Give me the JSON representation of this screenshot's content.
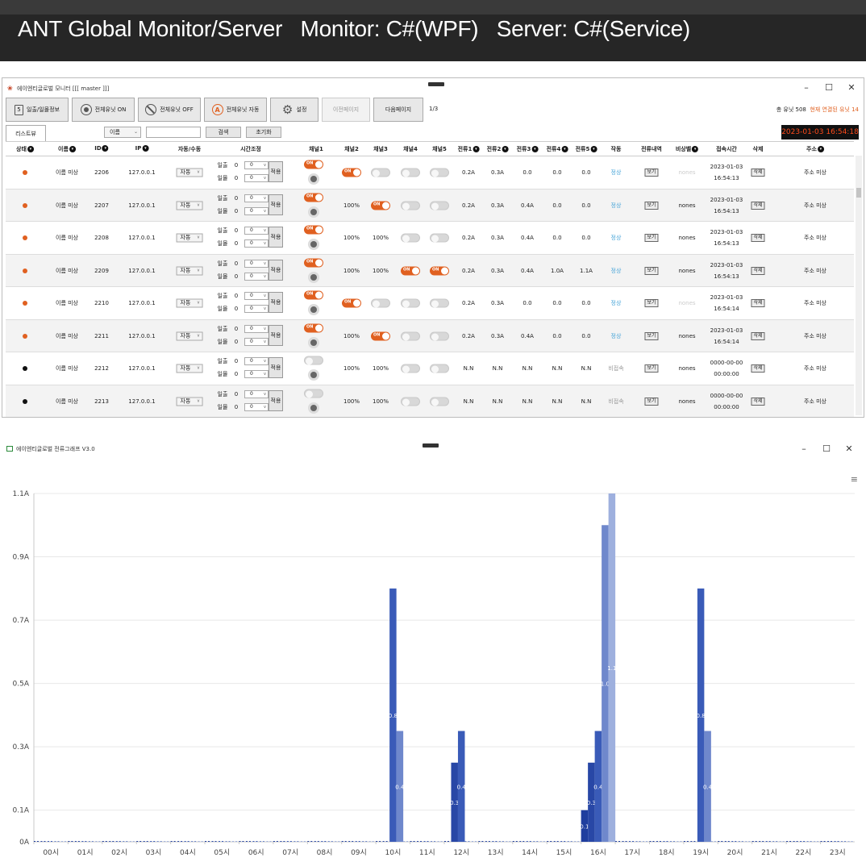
{
  "banner": {
    "title": "ANT Global Monitor/Server   Monitor: C#(WPF)   Server: C#(Service)"
  },
  "monitor": {
    "window_title": "에이엔티글로벌 모니터 [[[ master ]]]",
    "toolbar": {
      "daily_info": "일출/일몰정보",
      "all_on": "전체유닛 ON",
      "all_off": "전체유닛 OFF",
      "all_auto": "전체유닛 자동",
      "settings": "설정",
      "prev_page": "이전페이지",
      "next_page": "다음페이지",
      "page": "1/3",
      "total_units": "총 유닛 508",
      "connected_units": "현재 연결된 유닛 14"
    },
    "filter": {
      "tab": "리스트뷰",
      "field_select": "이름",
      "search_value": "",
      "search_btn": "검색",
      "reset_btn": "초기화",
      "clock": "2023-01-03 16:54:18"
    },
    "columns": [
      "상태",
      "이름",
      "ID",
      "IP",
      "자동/수동",
      "시간조정",
      "채널1",
      "채널2",
      "채널3",
      "채널4",
      "채널5",
      "전류1",
      "전류2",
      "전류3",
      "전류4",
      "전류5",
      "작동",
      "전류내역",
      "비상벨",
      "접속시간",
      "삭제",
      "주소"
    ],
    "sortable": [
      true,
      true,
      true,
      true,
      false,
      false,
      false,
      false,
      false,
      false,
      false,
      true,
      true,
      true,
      true,
      true,
      false,
      false,
      true,
      false,
      false,
      true
    ],
    "time_labels": {
      "sunrise": "일출",
      "sunset": "일몰",
      "zero": "0",
      "apply": "적용"
    },
    "row_buttons": {
      "view": "보기",
      "delete": "삭제"
    },
    "rows": [
      {
        "status": "on",
        "name": "이름 미상",
        "id": "2206",
        "ip": "127.0.0.1",
        "mode": "자동",
        "ch1": "on",
        "ch2": "toggle-on",
        "ch3": "toggle-off",
        "ch4": "toggle-off",
        "ch5": "toggle-off",
        "i1": "0.2A",
        "i2": "0.3A",
        "i3": "0.0",
        "i4": "0.0",
        "i5": "0.0",
        "state": "정상",
        "bell": "nones",
        "bell_dim": true,
        "date": "2023-01-03",
        "time": "16:54:13",
        "addr": "주소 미상"
      },
      {
        "status": "on",
        "name": "이름 미상",
        "id": "2207",
        "ip": "127.0.0.1",
        "mode": "자동",
        "ch1": "on",
        "ch2": "100%",
        "ch3": "toggle-on",
        "ch4": "toggle-off",
        "ch5": "toggle-off",
        "i1": "0.2A",
        "i2": "0.3A",
        "i3": "0.4A",
        "i4": "0.0",
        "i5": "0.0",
        "state": "정상",
        "bell": "nones",
        "bell_dim": false,
        "date": "2023-01-03",
        "time": "16:54:13",
        "addr": "주소 미상"
      },
      {
        "status": "on",
        "name": "이름 미상",
        "id": "2208",
        "ip": "127.0.0.1",
        "mode": "자동",
        "ch1": "on",
        "ch2": "100%",
        "ch3": "100%",
        "ch4": "toggle-off",
        "ch5": "toggle-off",
        "i1": "0.2A",
        "i2": "0.3A",
        "i3": "0.4A",
        "i4": "0.0",
        "i5": "0.0",
        "state": "정상",
        "bell": "nones",
        "bell_dim": false,
        "date": "2023-01-03",
        "time": "16:54:13",
        "addr": "주소 미상"
      },
      {
        "status": "on",
        "name": "이름 미상",
        "id": "2209",
        "ip": "127.0.0.1",
        "mode": "자동",
        "ch1": "on",
        "ch2": "100%",
        "ch3": "100%",
        "ch4": "toggle-on",
        "ch5": "toggle-on",
        "i1": "0.2A",
        "i2": "0.3A",
        "i3": "0.4A",
        "i4": "1.0A",
        "i5": "1.1A",
        "state": "정상",
        "bell": "nones",
        "bell_dim": false,
        "date": "2023-01-03",
        "time": "16:54:13",
        "addr": "주소 미상"
      },
      {
        "status": "on",
        "name": "이름 미상",
        "id": "2210",
        "ip": "127.0.0.1",
        "mode": "자동",
        "ch1": "on",
        "ch2": "toggle-on",
        "ch3": "toggle-off",
        "ch4": "toggle-off",
        "ch5": "toggle-off",
        "i1": "0.2A",
        "i2": "0.3A",
        "i3": "0.0",
        "i4": "0.0",
        "i5": "0.0",
        "state": "정상",
        "bell": "nones",
        "bell_dim": true,
        "date": "2023-01-03",
        "time": "16:54:14",
        "addr": "주소 미상"
      },
      {
        "status": "on",
        "name": "이름 미상",
        "id": "2211",
        "ip": "127.0.0.1",
        "mode": "자동",
        "ch1": "on",
        "ch2": "100%",
        "ch3": "toggle-on",
        "ch4": "toggle-off",
        "ch5": "toggle-off",
        "i1": "0.2A",
        "i2": "0.3A",
        "i3": "0.4A",
        "i4": "0.0",
        "i5": "0.0",
        "state": "정상",
        "bell": "nones",
        "bell_dim": false,
        "date": "2023-01-03",
        "time": "16:54:14",
        "addr": "주소 미상"
      },
      {
        "status": "off",
        "name": "이름 미상",
        "id": "2212",
        "ip": "127.0.0.1",
        "mode": "자동",
        "ch1": "off",
        "ch2": "100%",
        "ch3": "100%",
        "ch4": "toggle-off",
        "ch5": "toggle-off",
        "i1": "N.N",
        "i2": "N.N",
        "i3": "N.N",
        "i4": "N.N",
        "i5": "N.N",
        "state": "비접속",
        "bell": "nones",
        "bell_dim": false,
        "date": "0000-00-00",
        "time": "00:00:00",
        "addr": "주소 미상"
      },
      {
        "status": "off",
        "name": "이름 미상",
        "id": "2213",
        "ip": "127.0.0.1",
        "mode": "자동",
        "ch1": "off",
        "ch2": "100%",
        "ch3": "100%",
        "ch4": "toggle-off",
        "ch5": "toggle-off",
        "i1": "N.N",
        "i2": "N.N",
        "i3": "N.N",
        "i4": "N.N",
        "i5": "N.N",
        "state": "비접속",
        "bell": "nones",
        "bell_dim": false,
        "date": "0000-00-00",
        "time": "00:00:00",
        "addr": "주소 미상"
      }
    ],
    "colors": {
      "accent": "#e06020",
      "ok": "#46a4d8",
      "clock_text": "#ff4a1a"
    }
  },
  "graph": {
    "window_title": "에이엔티글로벌 전류그래프 V3.0",
    "menu_icon": "hamburger-icon"
  },
  "chart_data": {
    "type": "bar",
    "categories": [
      "00시",
      "01시",
      "02시",
      "03시",
      "04시",
      "05시",
      "06시",
      "07시",
      "08시",
      "09시",
      "10시",
      "11시",
      "12시",
      "13시",
      "14시",
      "15시",
      "16시",
      "17시",
      "18시",
      "19시",
      "20시",
      "21시",
      "22시",
      "23시"
    ],
    "series": [
      {
        "values": [
          0,
          0,
          0,
          0,
          0,
          0,
          0,
          0,
          0,
          0,
          0,
          0,
          0,
          0,
          0,
          0,
          0.1,
          0,
          0,
          0,
          0,
          0,
          0,
          0
        ],
        "labels": [
          "",
          "",
          "",
          "",
          "",
          "",
          "",
          "",
          "",
          "",
          "",
          "",
          "",
          "",
          "",
          "",
          "0.1",
          "",
          "",
          "",
          "",
          "",
          "",
          ""
        ],
        "color": "#1f3e9e"
      },
      {
        "values": [
          0,
          0,
          0,
          0,
          0,
          0,
          0,
          0,
          0,
          0,
          0,
          0,
          0.25,
          0,
          0,
          0,
          0.25,
          0,
          0,
          0,
          0,
          0,
          0,
          0
        ],
        "labels": [
          "",
          "",
          "",
          "",
          "",
          "",
          "",
          "",
          "",
          "",
          "",
          "",
          "0.3",
          "",
          "",
          "",
          "0.3",
          "",
          "",
          "",
          "",
          "",
          "",
          ""
        ],
        "color": "#2847a6"
      },
      {
        "values": [
          0,
          0,
          0,
          0,
          0,
          0,
          0,
          0,
          0,
          0,
          0.8,
          0,
          0.35,
          0,
          0,
          0,
          0.35,
          0,
          0,
          0.8,
          0,
          0,
          0,
          0
        ],
        "labels": [
          "",
          "",
          "",
          "",
          "",
          "",
          "",
          "",
          "",
          "",
          "0.8",
          "",
          "0.4",
          "",
          "",
          "",
          "0.4",
          "",
          "",
          "0.8",
          "",
          "",
          "",
          ""
        ],
        "color": "#3a5bb8"
      },
      {
        "values": [
          0,
          0,
          0,
          0,
          0,
          0,
          0,
          0,
          0,
          0,
          0.35,
          0,
          0,
          0,
          0,
          0,
          1.0,
          0,
          0,
          0.35,
          0,
          0,
          0,
          0
        ],
        "labels": [
          "",
          "",
          "",
          "",
          "",
          "",
          "",
          "",
          "",
          "",
          "0.4",
          "",
          "",
          "",
          "",
          "",
          "1.0",
          "",
          "",
          "0.4",
          "",
          "",
          "",
          ""
        ],
        "color": "#6f88cc"
      },
      {
        "values": [
          0,
          0,
          0,
          0,
          0,
          0,
          0,
          0,
          0,
          0,
          0,
          0,
          0,
          0,
          0,
          0,
          1.1,
          0,
          0,
          0,
          0,
          0,
          0,
          0
        ],
        "labels": [
          "",
          "",
          "",
          "",
          "",
          "",
          "",
          "",
          "",
          "",
          "",
          "",
          "",
          "",
          "",
          "",
          "1.1",
          "",
          "",
          "",
          "",
          "",
          "",
          ""
        ],
        "color": "#9eb0de"
      }
    ],
    "yticks": [
      "0A",
      "0.1A",
      "0.3A",
      "0.5A",
      "0.7A",
      "0.9A",
      "1.1A"
    ],
    "ylim": [
      0,
      1.1
    ],
    "grid": true
  }
}
